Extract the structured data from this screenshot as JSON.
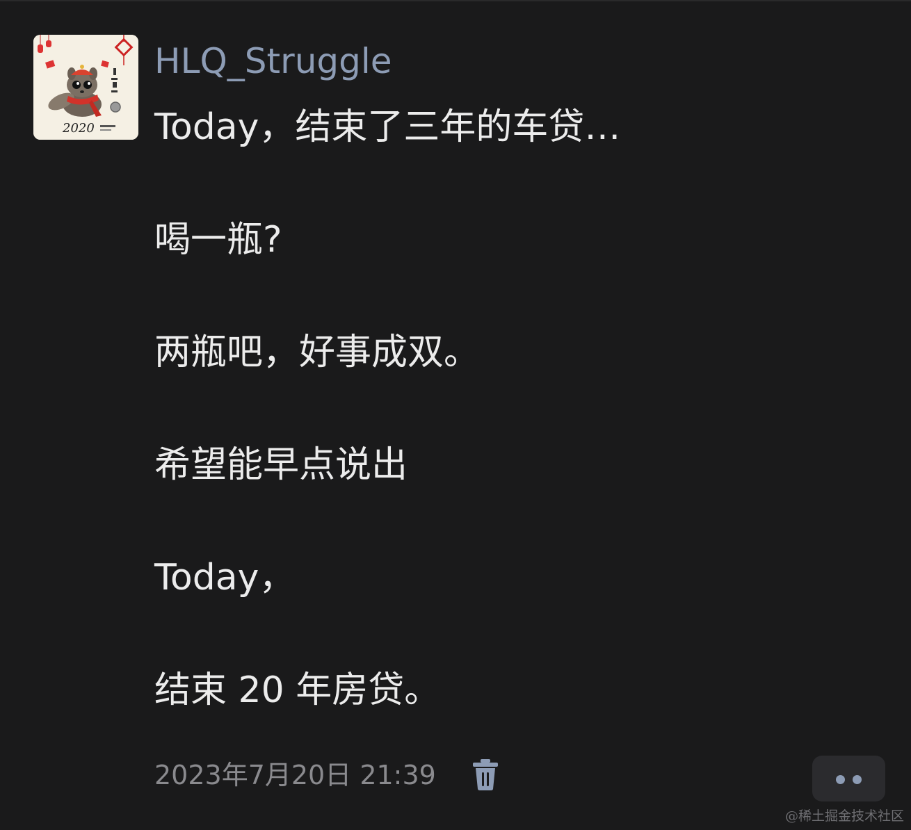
{
  "post": {
    "username": "HLQ_Struggle",
    "lines": [
      "Today，结束了三年的车贷…",
      "喝一瓶?",
      "两瓶吧，好事成双。",
      "希望能早点说出",
      "Today，",
      "结束 20 年房贷。"
    ],
    "timestamp": "2023年7月20日 21:39"
  },
  "avatar": {
    "text_year": "2020"
  },
  "icons": {
    "delete": "trash-icon",
    "more": "more-dots-icon"
  },
  "colors": {
    "background": "#1a1a1b",
    "username": "#8d9cb5",
    "body_text": "#ececec",
    "meta_text": "#8a8a8e",
    "accent": "#8d9cb5"
  },
  "watermark": "@稀土掘金技术社区"
}
